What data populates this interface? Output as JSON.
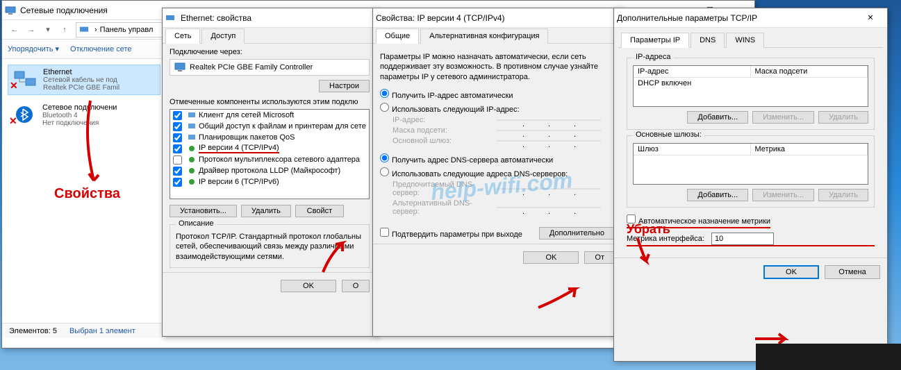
{
  "explorer": {
    "title": "Сетевые подключения",
    "breadcrumb": "Панель управл",
    "cmd_organize": "Упорядочить ▾",
    "cmd_disable": "Отключение сете",
    "items": [
      {
        "name": "Ethernet",
        "line2": "Сетевой кабель не под",
        "line3": "Realtek PCIe GBE Famil",
        "status": "x"
      },
      {
        "name": "Сетевое подключени",
        "line2": "Bluetooth 4",
        "line3": "Нет подключения",
        "status": "x"
      }
    ],
    "status_count": "Элементов: 5",
    "status_selected": "Выбран 1 элемент"
  },
  "annotations": {
    "properties": "Свойства",
    "remove": "Убрать"
  },
  "eth": {
    "title": "Ethernet: свойства",
    "tab_network": "Сеть",
    "tab_access": "Доступ",
    "connect_via": "Подключение через:",
    "adapter": "Realtek PCIe GBE Family Controller",
    "configure": "Настрои",
    "components_label": "Отмеченные компоненты используются этим подклю",
    "components": [
      {
        "label": "Клиент для сетей Microsoft",
        "checked": true
      },
      {
        "label": "Общий доступ к файлам и принтерам для сете",
        "checked": true
      },
      {
        "label": "Планировщик пакетов QoS",
        "checked": true
      },
      {
        "label": "IP версии 4 (TCP/IPv4)",
        "checked": true,
        "selected": true
      },
      {
        "label": "Протокол мультиплексора сетевого адаптера",
        "checked": false
      },
      {
        "label": "Драйвер протокола LLDP (Майкрософт)",
        "checked": true
      },
      {
        "label": "IP версии 6 (TCP/IPv6)",
        "checked": true
      }
    ],
    "install": "Установить...",
    "remove": "Удалить",
    "properties": "Свойст",
    "description_label": "Описание",
    "description": "Протокол TCP/IP. Стандартный протокол глобальны сетей, обеспечивающий связь между различными взаимодействующими сетями.",
    "ok": "OK",
    "cancel": "О"
  },
  "ipv4": {
    "title": "Свойства: IP версии 4 (TCP/IPv4)",
    "tab_general": "Общие",
    "tab_alt": "Альтернативная конфигурация",
    "intro": "Параметры IP можно назначать автоматически, если сеть поддерживает эту возможность. В противном случае узнайте параметры IP у сетевого администратора.",
    "auto_ip": "Получить IP-адрес автоматически",
    "manual_ip": "Использовать следующий IP-адрес:",
    "ip_label": "IP-адрес:",
    "mask_label": "Маска подсети:",
    "gateway_label": "Основной шлюз:",
    "auto_dns": "Получить адрес DNS-сервера автоматически",
    "manual_dns": "Использовать следующие адреса DNS-серверов:",
    "dns1_label": "Предпочитаемый DNS-сервер:",
    "dns2_label": "Альтернативный DNS-сервер:",
    "confirm_exit": "Подтвердить параметры при выходе",
    "advanced": "Дополнительно",
    "ok": "OK",
    "cancel": "От"
  },
  "adv": {
    "title": "Дополнительные параметры TCP/IP",
    "tab_ip": "Параметры IP",
    "tab_dns": "DNS",
    "tab_wins": "WINS",
    "group_addresses": "IP-адреса",
    "col_ip": "IP-адрес",
    "col_mask": "Маска подсети",
    "dhcp_row": "DHCP включен",
    "group_gateways": "Основные шлюзы:",
    "col_gateway": "Шлюз",
    "col_metric": "Метрика",
    "add": "Добавить...",
    "edit": "Изменить...",
    "delete": "Удалить",
    "auto_metric": "Автоматическое назначение метрики",
    "metric_label": "Метрика интерфейса:",
    "metric_value": "10",
    "ok": "OK",
    "cancel": "Отмена"
  },
  "watermark": "help-wifi.com"
}
